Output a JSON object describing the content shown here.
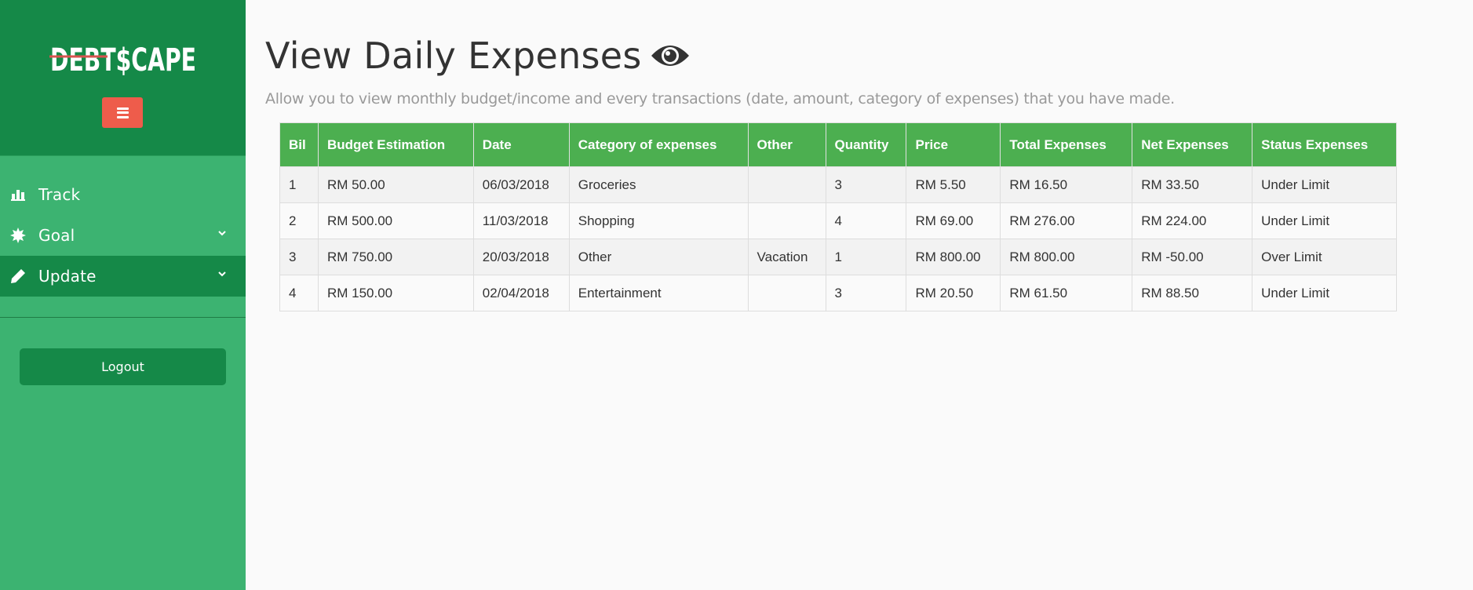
{
  "brand": {
    "logo_text": "DEBT$CAPE",
    "accent": "#158948",
    "sidebar_bg": "#3cb371",
    "toggle_color": "#ee5c4b",
    "header_green": "#4caf50"
  },
  "sidebar": {
    "items": [
      {
        "label": "Track",
        "icon": "bar-chart-icon",
        "has_chevron": false,
        "active": false
      },
      {
        "label": "Goal",
        "icon": "starburst-icon",
        "has_chevron": true,
        "active": false
      },
      {
        "label": "Update",
        "icon": "pencil-icon",
        "has_chevron": true,
        "active": true
      }
    ],
    "logout_label": "Logout"
  },
  "main": {
    "title": "View Daily Expenses",
    "title_icon": "eye-icon",
    "subtitle": "Allow you to view monthly budget/income and every transactions (date, amount, category of expenses) that you have made."
  },
  "table": {
    "columns": [
      "Bil",
      "Budget Estimation",
      "Date",
      "Category of expenses",
      "Other",
      "Quantity",
      "Price",
      "Total Expenses",
      "Net Expenses",
      "Status Expenses"
    ],
    "rows": [
      [
        "1",
        "RM 50.00",
        "06/03/2018",
        "Groceries",
        "",
        "3",
        "RM 5.50",
        "RM 16.50",
        "RM 33.50",
        "Under Limit"
      ],
      [
        "2",
        "RM 500.00",
        "11/03/2018",
        "Shopping",
        "",
        "4",
        "RM 69.00",
        "RM 276.00",
        "RM 224.00",
        "Under Limit"
      ],
      [
        "3",
        "RM 750.00",
        "20/03/2018",
        "Other",
        "Vacation",
        "1",
        "RM 800.00",
        "RM 800.00",
        "RM -50.00",
        "Over Limit"
      ],
      [
        "4",
        "RM 150.00",
        "02/04/2018",
        "Entertainment",
        "",
        "3",
        "RM 20.50",
        "RM 61.50",
        "RM 88.50",
        "Under Limit"
      ]
    ]
  }
}
